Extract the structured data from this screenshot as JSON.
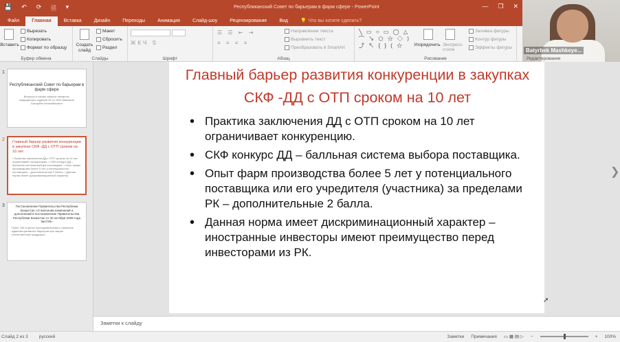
{
  "app": {
    "title": "Республиканский Совет по барьерам в фарм сфере - PowerPoint",
    "quick_access": [
      "💾",
      "↶",
      "⟳",
      "🗎",
      "▾"
    ],
    "window_controls": [
      "—",
      "❐",
      "✕"
    ],
    "tabs": [
      "Файл",
      "Главная",
      "Вставка",
      "Дизайн",
      "Переходы",
      "Анимация",
      "Слайд-шоу",
      "Рецензирование",
      "Вид"
    ],
    "tell_me": "Что вы хотите сделать?"
  },
  "ribbon": {
    "clipboard": {
      "paste": "Вставить",
      "cut": "Вырезать",
      "copy": "Копировать",
      "format_painter": "Формат по образцу",
      "label": "Буфер обмена"
    },
    "slides": {
      "new_slide": "Создать слайд",
      "layout": "Макет",
      "reset": "Сбросить",
      "section": "Раздел",
      "label": "Слайды"
    },
    "font": {
      "label": "Шрифт"
    },
    "paragraph": {
      "direction": "Направление текста",
      "align": "Выровнять текст",
      "smartart": "Преобразовать в SmartArt",
      "label": "Абзац"
    },
    "drawing": {
      "arrange": "Упорядочить",
      "quick_styles": "Экспресс-стили",
      "fill": "Заливка фигуры",
      "outline": "Контур фигуры",
      "effects": "Эффекты фигуры",
      "label": "Рисование",
      "shapes_row1": "╲ ▭ ○ ▭ ◯ △",
      "shapes_row2": "⌒ ↘ ⬠ ☆ ◇ ⟩",
      "shapes_row3": "⤴ ↖ { } ( ☆"
    },
    "editing_label": "Редактирование"
  },
  "webcam": {
    "name": "Batyrbek Mashkeye..."
  },
  "thumbnails": [
    {
      "num": "1",
      "title": "Республиканский Совет по барьерам в фарм сфере",
      "body": "Вопросы в сфере закупок лекарств, медицинских изделий 20.11.2020 Машкеев Батырбек Кенжебекович"
    },
    {
      "num": "2",
      "title": "Главный барьер развития конкуренции в закупках СКФ -ДД с ОТП сроком на 10 лет",
      "body": "• Практика заключения ДД с ОТП сроком на 10 лет ограничивает конкуренцию. • СКФ конкурс ДД – балльная система выбора поставщика. • Опыт фарм производства более 5 лет у потенциального поставщика – дополнительные 2 балла. • Данная норма имеет дискриминационный характер"
    },
    {
      "num": "3",
      "title": "Постановление Правительства Республики Казахстан «О внесении изменений и дополнений в постановление Правительства Республики Казахстан от 30 октября 2009 года №1729»",
      "body": "Пункт 106 в целях последовательного снижения административных барьеров при закупе отечественной продукции..."
    }
  ],
  "slide": {
    "title": "Главный барьер развития конкуренции в закупках СКФ -ДД с ОТП сроком на 10 лет",
    "bullets": [
      "Практика заключения ДД с ОТП сроком на 10 лет ограничивает конкуренцию.",
      "СКФ конкурс ДД – балльная система выбора поставщика.",
      "Опыт фарм производства более 5 лет у потенциального поставщика или его учредителя (участника) за пределами РК – дополнительные 2 балла.",
      "Данная норма имеет дискриминационный характер – иностранные инвесторы имеют преимущество перед инвесторами из РК."
    ]
  },
  "notes": {
    "placeholder": "Заметки к слайду"
  },
  "status": {
    "slide_info": "Слайд 2 из 3",
    "language": "русский",
    "notes_btn": "Заметки",
    "comments_btn": "Примечания",
    "zoom": "100%"
  },
  "colors": {
    "accent": "#b7472a",
    "title_red": "#c0392b"
  }
}
